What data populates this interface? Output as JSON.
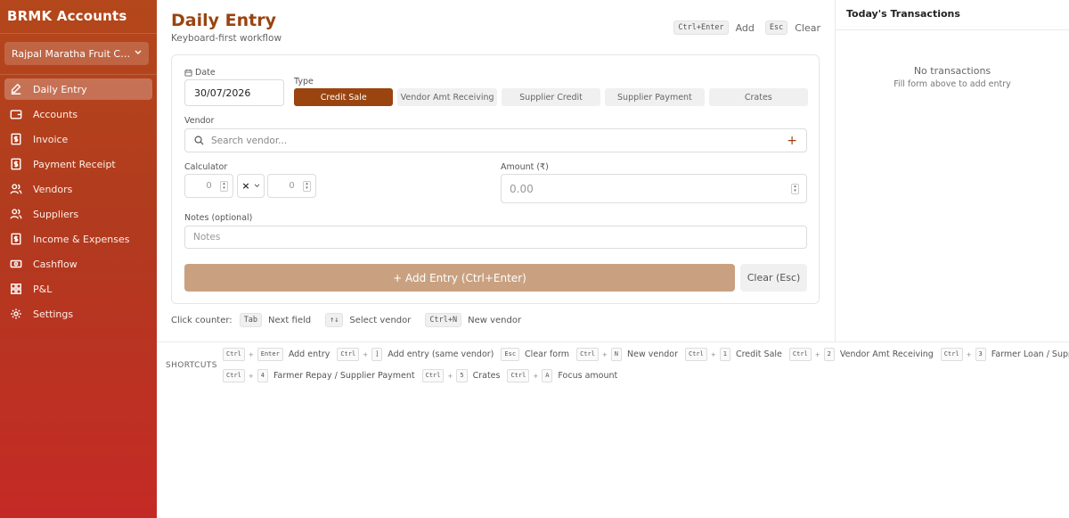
{
  "app": {
    "title": "BRMK Accounts"
  },
  "company": {
    "name": "Rajpal Maratha Fruit Com..."
  },
  "sidebar": {
    "items": [
      {
        "label": "Daily Entry",
        "icon": "edit-icon",
        "active": true
      },
      {
        "label": "Accounts",
        "icon": "wallet-icon",
        "active": false
      },
      {
        "label": "Invoice",
        "icon": "invoice-icon",
        "active": false
      },
      {
        "label": "Payment Receipt",
        "icon": "receipt-icon",
        "active": false
      },
      {
        "label": "Vendors",
        "icon": "users-icon",
        "active": false
      },
      {
        "label": "Suppliers",
        "icon": "users-icon",
        "active": false
      },
      {
        "label": "Income & Expenses",
        "icon": "dollar-icon",
        "active": false
      },
      {
        "label": "Cashflow",
        "icon": "cash-icon",
        "active": false
      },
      {
        "label": "P&L",
        "icon": "grid-icon",
        "active": false
      },
      {
        "label": "Settings",
        "icon": "gear-icon",
        "active": false
      }
    ]
  },
  "header": {
    "title": "Daily Entry",
    "subtitle": "Keyboard-first workflow",
    "add_key": "Ctrl+Enter",
    "add_label": "Add",
    "clear_key": "Esc",
    "clear_label": "Clear"
  },
  "form": {
    "date_label": "Date",
    "date_value": "30/07/2026",
    "type_label": "Type",
    "types": [
      "Credit Sale",
      "Vendor Amt Receiving",
      "Supplier Credit",
      "Supplier Payment",
      "Crates"
    ],
    "active_type": "Credit Sale",
    "vendor_label": "Vendor",
    "vendor_placeholder": "Search vendor...",
    "calculator_label": "Calculator",
    "calc_a": "0",
    "calc_operator": "×",
    "calc_b": "0",
    "amount_label": "Amount (₹)",
    "amount_placeholder": "0.00",
    "notes_label": "Notes (optional)",
    "notes_placeholder": "Notes",
    "add_button": "+  Add Entry (Ctrl+Enter)",
    "clear_button": "Clear (Esc)"
  },
  "counter": {
    "label": "Click counter:",
    "items": [
      {
        "key": "Tab",
        "text": "Next field"
      },
      {
        "key": "↑↓",
        "text": "Select vendor"
      },
      {
        "key": "Ctrl+N",
        "text": "New vendor"
      }
    ]
  },
  "transactions": {
    "title": "Today's Transactions",
    "empty": "No transactions",
    "empty_sub": "Fill form above to add entry"
  },
  "shortcuts": {
    "title": "SHORTCUTS",
    "line1": [
      {
        "k1": "Ctrl",
        "k2": "Enter",
        "desc": "Add entry"
      },
      {
        "k1": "Ctrl",
        "k2": "]",
        "desc": "Add entry (same vendor)"
      },
      {
        "k1": "Esc",
        "k2": "",
        "desc": "Clear form"
      },
      {
        "k1": "Ctrl",
        "k2": "N",
        "desc": "New vendor"
      },
      {
        "k1": "Ctrl",
        "k2": "1",
        "desc": "Credit Sale"
      },
      {
        "k1": "Ctrl",
        "k2": "2",
        "desc": "Vendor Amt Receiving"
      },
      {
        "k1": "Ctrl",
        "k2": "3",
        "desc": "Farmer Loan / Supplier Credit"
      }
    ],
    "line2": [
      {
        "k1": "Ctrl",
        "k2": "4",
        "desc": "Farmer Repay / Supplier Payment"
      },
      {
        "k1": "Ctrl",
        "k2": "5",
        "desc": "Crates"
      },
      {
        "k1": "Ctrl",
        "k2": "A",
        "desc": "Focus amount"
      }
    ]
  },
  "colors": {
    "accent": "#9a4410",
    "sidebar_top": "#b4471b",
    "sidebar_bottom": "#c42a25"
  }
}
